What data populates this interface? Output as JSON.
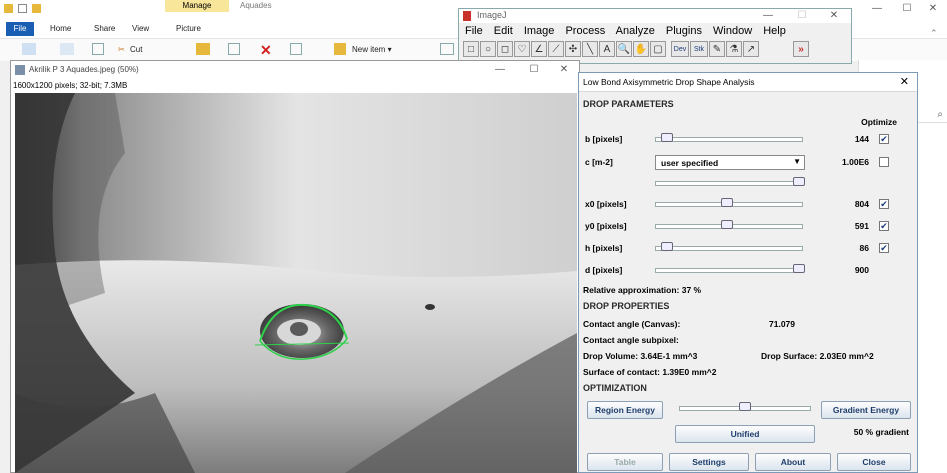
{
  "explorer": {
    "context_tab": "Manage",
    "title": "Aquades",
    "tabs": [
      "File",
      "Home",
      "Share",
      "View",
      "Picture Tools"
    ],
    "ribbon": {
      "cut": "Cut",
      "new_item": "New item"
    },
    "win_min": "—",
    "win_max": "☐",
    "win_close": "✕",
    "search_icon": "search-icon"
  },
  "imagej": {
    "title": "ImageJ",
    "menu": [
      "File",
      "Edit",
      "Image",
      "Process",
      "Analyze",
      "Plugins",
      "Window",
      "Help"
    ],
    "tools": [
      "□",
      "○",
      "◻",
      "♡",
      "∠",
      "⟋",
      "✣",
      "╲",
      "A",
      "🔍",
      "✋",
      "▢",
      "Dev",
      "Stk",
      "✎",
      "⚗",
      "↗",
      "»"
    ]
  },
  "image_window": {
    "title": "Akrilik P 3 Aquades.jpeg (50%)",
    "info": "1600x1200 pixels; 32-bit; 7.3MB"
  },
  "dialog": {
    "title": "Low Bond Axisymmetric Drop Shape Analysis",
    "close": "✕",
    "drop_parameters": "DROP PARAMETERS",
    "optimize": "Optimize",
    "params": [
      {
        "label": "b [pixels]",
        "value": "144",
        "checked": true,
        "pos": 0.1
      },
      {
        "label": "x0 [pixels]",
        "value": "804",
        "checked": true,
        "pos": 0.5
      },
      {
        "label": "y0 [pixels]",
        "value": "591",
        "checked": true,
        "pos": 0.5
      },
      {
        "label": "h [pixels]",
        "value": "86",
        "checked": true,
        "pos": 0.1
      },
      {
        "label": "d [pixels]",
        "value": "900",
        "checked": false,
        "pos": 1.0
      }
    ],
    "c_label": "c [m-2]",
    "c_select": "user specified",
    "c_value": "1.00E6",
    "c_checked": false,
    "c_slider_pos": 1.0,
    "relative": "Relative approximation: 37 %",
    "drop_properties": "DROP PROPERTIES",
    "contact_canvas_label": "Contact angle (Canvas):",
    "contact_canvas_value": "71.079",
    "contact_subpixel": "Contact angle subpixel:",
    "drop_volume": "Drop Volume: 3.64E-1 mm^3",
    "drop_surface": "Drop Surface: 2.03E0 mm^2",
    "surface_contact": "Surface of contact: 1.39E0 mm^2",
    "optimization": "OPTIMIZATION",
    "region_energy": "Region Energy",
    "gradient_energy": "Gradient Energy",
    "opt_slider_pos": 0.5,
    "unified": "Unified",
    "gradient_percent": "50 % gradient",
    "btn_table": "Table",
    "btn_settings": "Settings",
    "btn_about": "About",
    "btn_close": "Close"
  }
}
